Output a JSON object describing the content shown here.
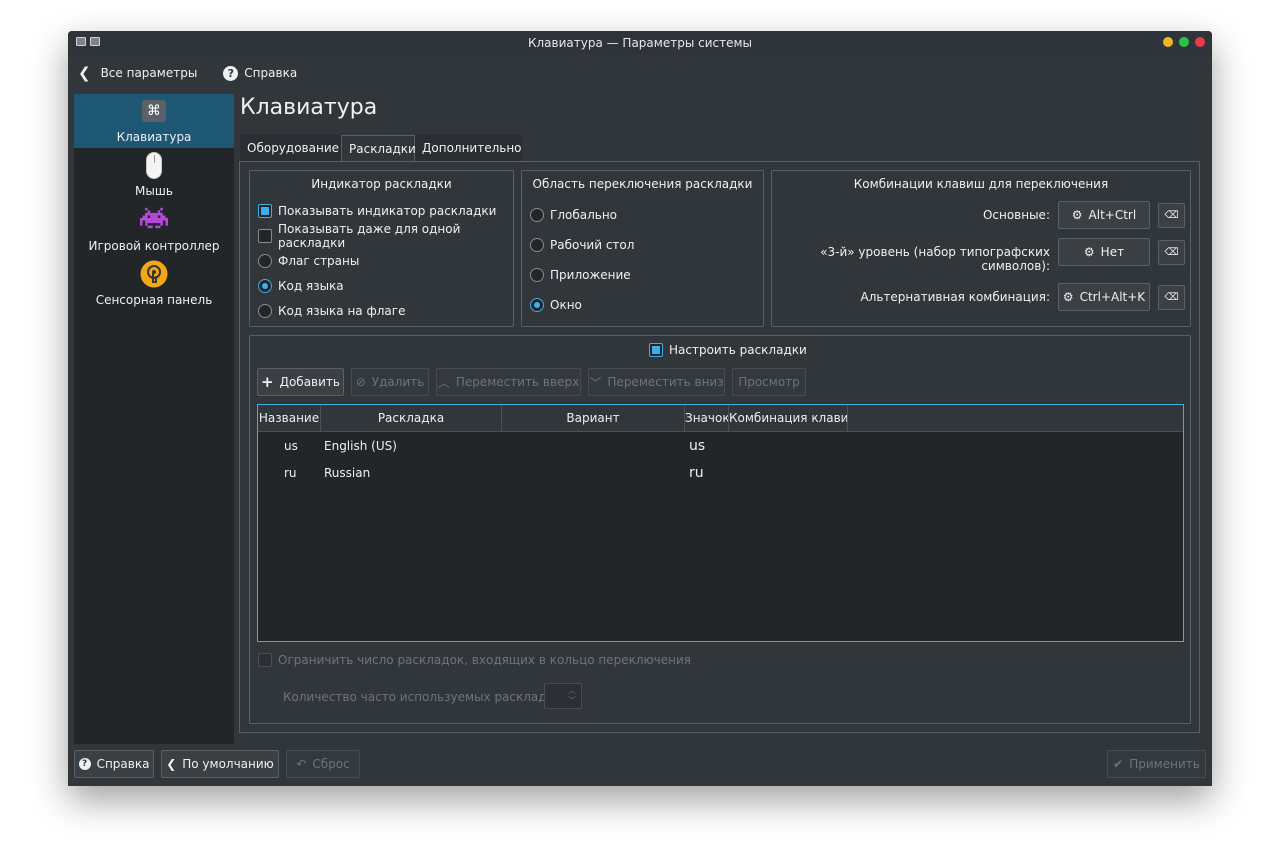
{
  "window": {
    "title": "Клавиатура — Параметры системы"
  },
  "colors": {
    "accent": "#3daee9",
    "dot_yellow": "#f4b629",
    "dot_green": "#2ec24b",
    "dot_red": "#ec3b48"
  },
  "nav": {
    "back_label": "Все параметры",
    "help_label": "Справка"
  },
  "sidebar": {
    "items": [
      {
        "label": "Клавиатура",
        "icon": "keyboard-command-icon",
        "active": true
      },
      {
        "label": "Мышь",
        "icon": "mouse-icon"
      },
      {
        "label": "Игровой контроллер",
        "icon": "space-invader-icon"
      },
      {
        "label": "Сенсорная панель",
        "icon": "touchpad-icon"
      }
    ]
  },
  "page": {
    "title": "Клавиатура"
  },
  "tabs": [
    {
      "label": "Оборудование"
    },
    {
      "label": "Раскладки",
      "active": true
    },
    {
      "label": "Дополнительно"
    }
  ],
  "indicator": {
    "title": "Индикатор раскладки",
    "show_indicator": "Показывать индикатор раскладки",
    "show_single": "Показывать даже для одной раскладки",
    "flag": "Флаг страны",
    "lang_code": "Код языка",
    "code_on_flag": "Код языка на флаге"
  },
  "switch_area": {
    "title": "Область переключения раскладки",
    "global": "Глобально",
    "desktop": "Рабочий стол",
    "application": "Приложение",
    "window": "Окно"
  },
  "shortcuts": {
    "title": "Комбинации клавиш для переключения",
    "main_label": "Основные:",
    "main_value": "Alt+Ctrl",
    "level3_label": "«3-й» уровень (набор типографских символов):",
    "level3_value": "Нет",
    "alt_label": "Альтернативная комбинация:",
    "alt_value": "Ctrl+Alt+K"
  },
  "layouts": {
    "configure_label": "Настроить раскладки",
    "add": "Добавить",
    "remove": "Удалить",
    "move_up": "Переместить вверх",
    "move_down": "Переместить вниз",
    "preview": "Просмотр",
    "columns": [
      "Название",
      "Раскладка",
      "Вариант",
      "Значок",
      "Комбинация клавиш"
    ],
    "rows": [
      {
        "name": "us",
        "layout": "English (US)",
        "variant": "",
        "icon": "us",
        "shortcut": ""
      },
      {
        "name": "ru",
        "layout": "Russian",
        "variant": "",
        "icon": "ru",
        "shortcut": ""
      }
    ],
    "limit_label": "Ограничить число раскладок, входящих в кольцо переключения",
    "count_label": "Количество часто используемых раскладок:"
  },
  "footer": {
    "help": "Справка",
    "defaults": "По умолчанию",
    "reset": "Сброс",
    "apply": "Применить"
  }
}
